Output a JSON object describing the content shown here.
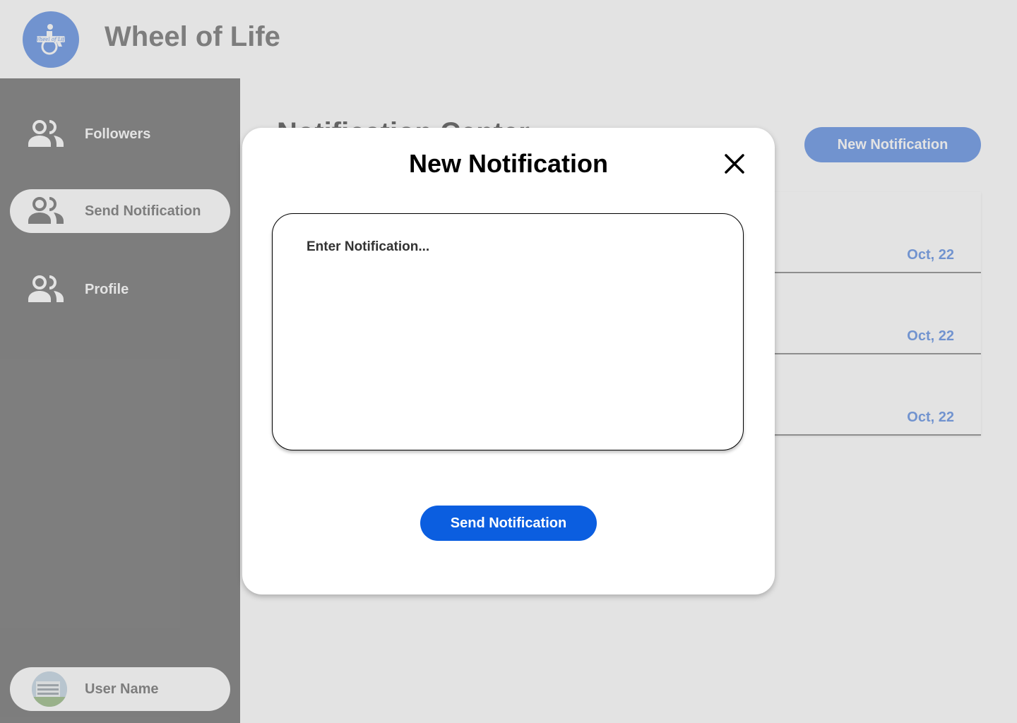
{
  "app": {
    "title": "Wheel of Life",
    "logo_text": "Wheel of Life"
  },
  "sidebar": {
    "items": [
      {
        "label": "Followers",
        "icon": "people-icon",
        "active": false
      },
      {
        "label": "Send Notification",
        "icon": "people-icon",
        "active": true
      },
      {
        "label": "Profile",
        "icon": "people-icon",
        "active": false
      }
    ],
    "user": {
      "name": "User Name"
    }
  },
  "main": {
    "title": "Notification Center",
    "new_button_label": "New Notification",
    "notifications": [
      {
        "date": "Oct, 22"
      },
      {
        "date": "Oct, 22"
      },
      {
        "date": "Oct, 22"
      }
    ]
  },
  "modal": {
    "title": "New Notification",
    "input_placeholder": "Enter Notification...",
    "input_value": "",
    "send_label": "Send Notification"
  },
  "colors": {
    "accent": "#1a5fd6",
    "send_button": "#0b5ee0",
    "sidebar": "#333333",
    "overlay": "#e5e5e5"
  }
}
